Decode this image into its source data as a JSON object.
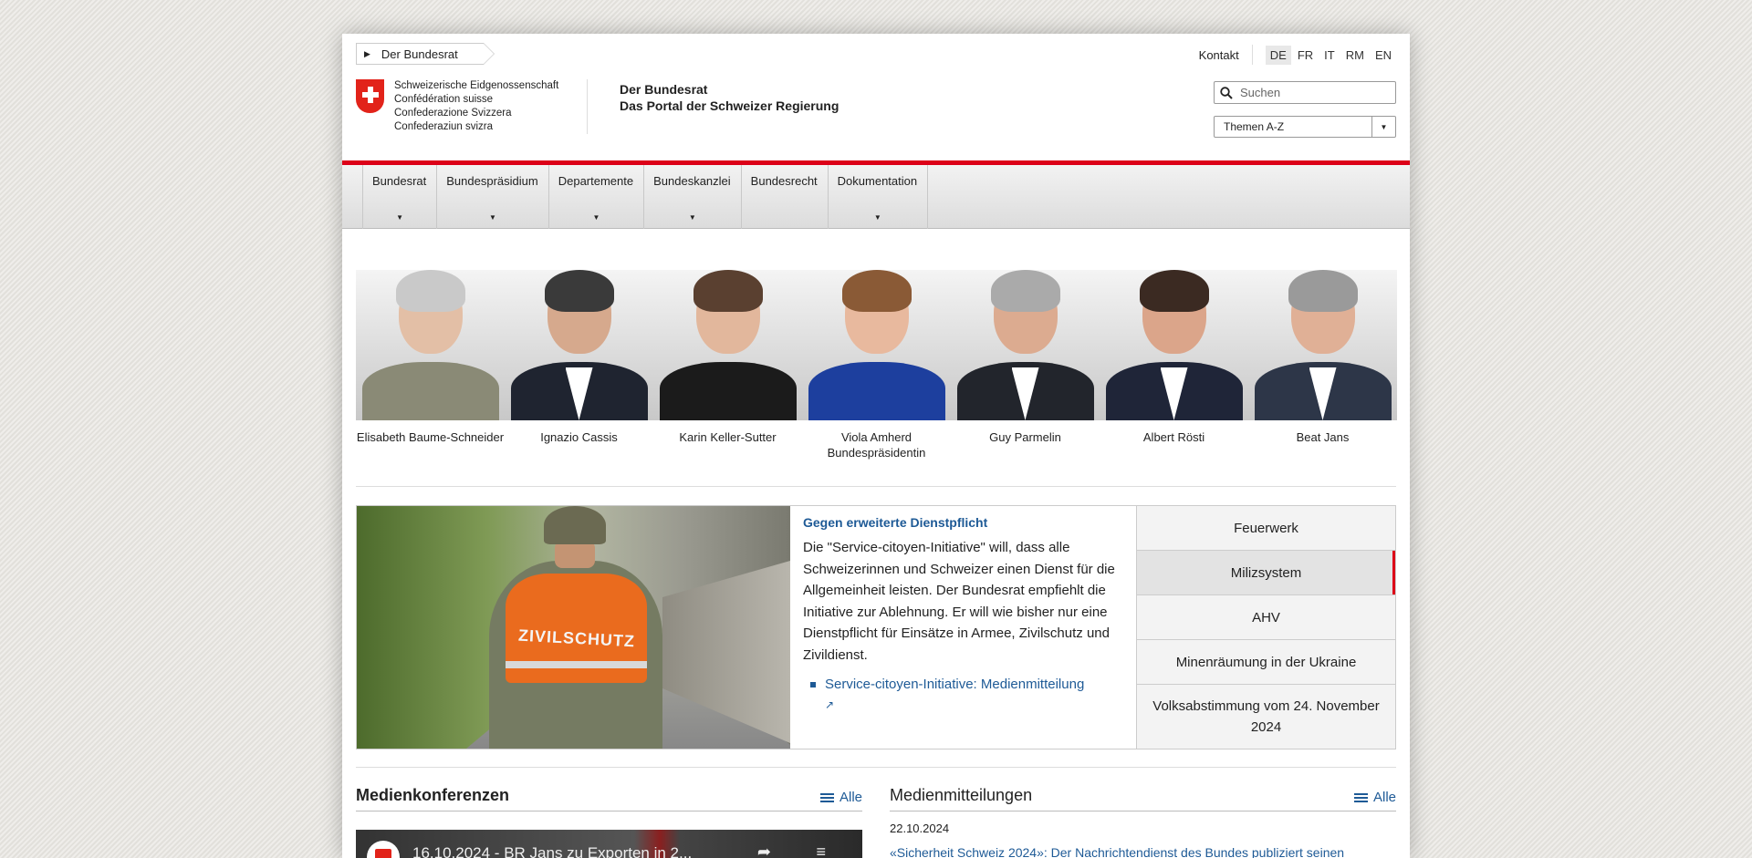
{
  "breadcrumb": {
    "label": "Der Bundesrat"
  },
  "toplinks": {
    "kontakt": "Kontakt",
    "languages": [
      "DE",
      "FR",
      "IT",
      "RM",
      "EN"
    ],
    "active_language": "DE"
  },
  "logo": {
    "lines": [
      "Schweizerische Eidgenossenschaft",
      "Confédération suisse",
      "Confederazione Svizzera",
      "Confederaziun svizra"
    ]
  },
  "portal": {
    "title": "Der Bundesrat",
    "subtitle": "Das Portal der Schweizer Regierung"
  },
  "search": {
    "placeholder": "Suchen"
  },
  "theme_select": {
    "value": "Themen A-Z"
  },
  "nav": {
    "items": [
      {
        "label": "Bundesrat",
        "has_dropdown": true
      },
      {
        "label": "Bundespräsidium",
        "has_dropdown": true
      },
      {
        "label": "Departemente",
        "has_dropdown": true
      },
      {
        "label": "Bundeskanzlei",
        "has_dropdown": true
      },
      {
        "label": "Bundesrecht",
        "has_dropdown": false
      },
      {
        "label": "Dokumentation",
        "has_dropdown": true
      }
    ]
  },
  "council": {
    "members": [
      {
        "name": "Elisabeth Baume-Schneider",
        "role": ""
      },
      {
        "name": "Ignazio Cassis",
        "role": ""
      },
      {
        "name": "Karin Keller-Sutter",
        "role": ""
      },
      {
        "name": "Viola Amherd",
        "role": "Bundespräsidentin"
      },
      {
        "name": "Guy Parmelin",
        "role": ""
      },
      {
        "name": "Albert Rösti",
        "role": ""
      },
      {
        "name": "Beat Jans",
        "role": ""
      }
    ]
  },
  "teaser": {
    "title": "Gegen erweiterte Dienstpflicht",
    "body": "Die \"Service-citoyen-Initiative\" will, dass alle Schweizerinnen und Schweizer einen Dienst für die Allgemeinheit leisten. Der Bundesrat empfiehlt die Initiative zur Ablehnung. Er will wie bisher nur eine Dienstpflicht für Einsätze in Armee, Zivilschutz und Zivildienst.",
    "link": "Service-citoyen-Initiative: Medienmitteilung",
    "image_text": "ZIVILSCHUTZ"
  },
  "topics": [
    {
      "label": "Feuerwerk",
      "active": false
    },
    {
      "label": "Milizsystem",
      "active": true
    },
    {
      "label": "AHV",
      "active": false
    },
    {
      "label": "Minenräumung in der Ukraine",
      "active": false
    },
    {
      "label": "Volksabstimmung vom 24. November 2024",
      "active": false
    }
  ],
  "media_conferences": {
    "title": "Medienkonferenzen",
    "all_label": "Alle",
    "video_title": "16.10.2024 - BR Jans zu Exporten in 2..."
  },
  "press_releases": {
    "title": "Medienmitteilungen",
    "all_label": "Alle",
    "date": "22.10.2024",
    "headline": "«Sicherheit Schweiz 2024»: Der Nachrichtendienst des Bundes publiziert seinen"
  },
  "colors": {
    "accent_red": "#dc0018",
    "link_blue": "#1e5a96",
    "flag_red": "#e2231a"
  }
}
